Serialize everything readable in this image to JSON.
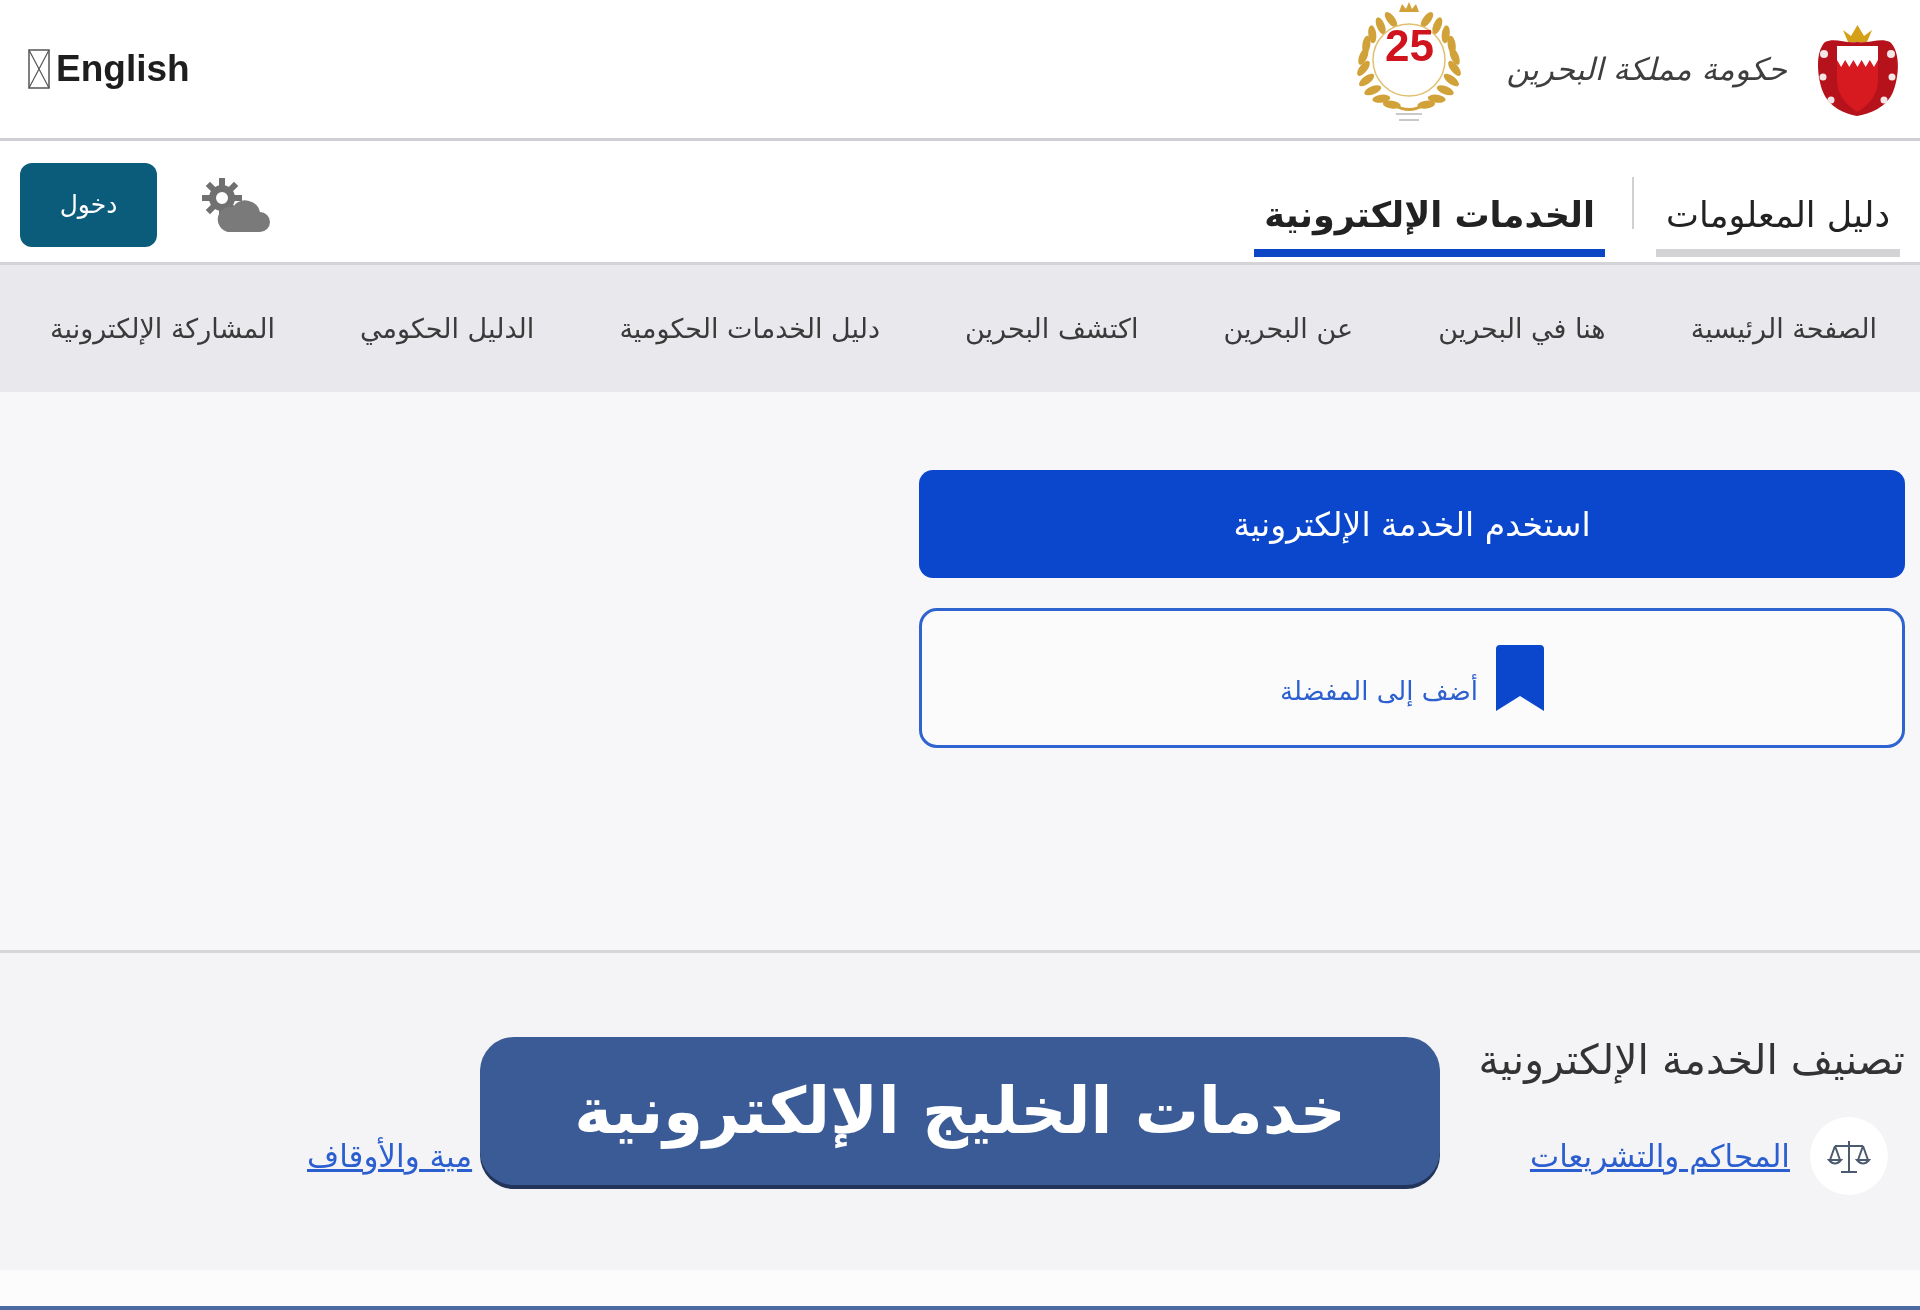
{
  "header": {
    "wordmark": "حكومة مملكة البحرين",
    "anniversary_number": "25",
    "language_link": "English"
  },
  "tabs": [
    {
      "label": "دليل المعلومات",
      "selected": false
    },
    {
      "label": "الخدمات الإلكترونية",
      "selected": true
    }
  ],
  "login_button": "دخول",
  "nav": [
    "الصفحة الرئيسية",
    "هنا في البحرين",
    "عن البحرين",
    "اكتشف البحرين",
    "دليل الخدمات الحكومية",
    "الدليل الحكومي",
    "المشاركة الإلكترونية"
  ],
  "actions": {
    "primary": "استخدم الخدمة الإلكترونية",
    "favorite": "أضف إلى المفضلة"
  },
  "category_section": {
    "title": "تصنيف الخدمة الإلكترونية",
    "links": [
      {
        "label": "المحاكم والتشريعات",
        "kind": "icon"
      },
      {
        "label": "مية والأوقاف",
        "kind": "text"
      }
    ]
  },
  "overlay_banner": {
    "text": "خدمات الخليج الإلكترونية"
  }
}
